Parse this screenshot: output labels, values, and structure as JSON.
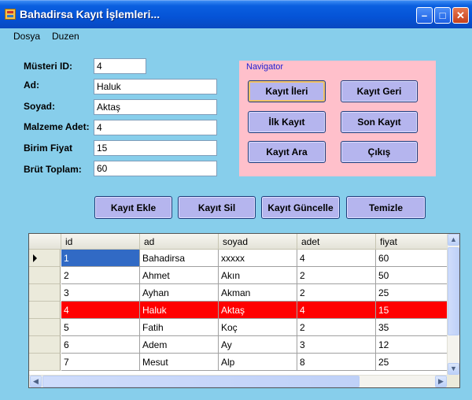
{
  "window": {
    "title": "Bahadirsa Kayıt İşlemleri..."
  },
  "titlebar_buttons": {
    "minimize": "–",
    "maximize": "□",
    "close": "✕"
  },
  "menu": [
    "Dosya",
    "Duzen"
  ],
  "form": {
    "musteri_id": {
      "label": "Müsteri ID:",
      "value": "4"
    },
    "ad": {
      "label": "Ad:",
      "value": "Haluk"
    },
    "soyad": {
      "label": "Soyad:",
      "value": "Aktaş"
    },
    "malzeme_adet": {
      "label": "Malzeme Adet:",
      "value": "4"
    },
    "birim_fiyat": {
      "label": "Birim Fiyat",
      "value": "15"
    },
    "brut_toplam": {
      "label": "Brüt Toplam:",
      "value": "60"
    }
  },
  "navigator": {
    "title": "Navigator",
    "buttons": [
      "Kayıt İleri",
      "Kayıt Geri",
      "İlk Kayıt",
      "Son Kayıt",
      "Kayıt Ara",
      "Çıkış"
    ]
  },
  "actions": [
    "Kayıt Ekle",
    "Kayıt Sil",
    "Kayıt Güncelle",
    "Temizle"
  ],
  "grid": {
    "columns": [
      "id",
      "ad",
      "soyad",
      "adet",
      "fiyat"
    ],
    "rows": [
      [
        "1",
        "Bahadirsa",
        "xxxxx",
        "4",
        "60"
      ],
      [
        "2",
        "Ahmet",
        " Akın",
        " 2",
        "50"
      ],
      [
        "3",
        "Ayhan",
        "Akman",
        "2",
        "25"
      ],
      [
        "4",
        "Haluk",
        "Aktaş",
        "4",
        "15"
      ],
      [
        "5",
        "Fatih",
        "Koç",
        "2",
        "35"
      ],
      [
        "6",
        "Adem",
        "Ay",
        "3",
        "12"
      ],
      [
        "7",
        "Mesut",
        "Alp",
        "8",
        "25"
      ]
    ],
    "current_row_index": 0,
    "highlighted_row_index": 3
  },
  "colors": {
    "form_background": "#87CEEB",
    "navigator_background": "#FFC0CB",
    "highlight_row": "#FF0000",
    "selected_cell": "#316AC5",
    "button_face": "#B5B5EE"
  }
}
